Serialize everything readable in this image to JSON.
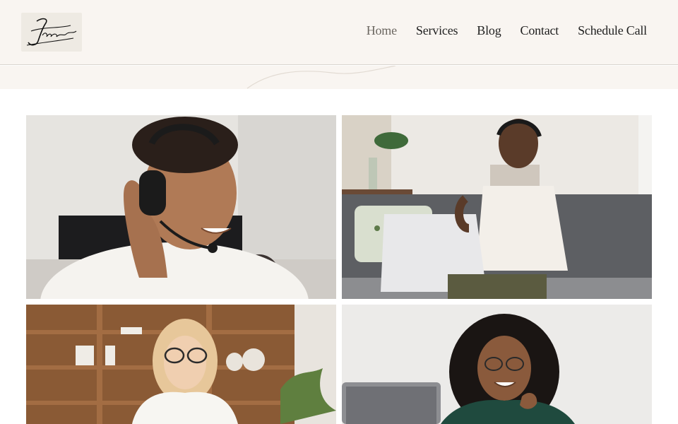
{
  "logo": {
    "text": "Jamal",
    "icon": "signature-logo"
  },
  "nav": {
    "items": [
      {
        "label": "Home",
        "active": true
      },
      {
        "label": "Services",
        "active": false
      },
      {
        "label": "Blog",
        "active": false
      },
      {
        "label": "Contact",
        "active": false
      },
      {
        "label": "Schedule Call",
        "active": false
      }
    ]
  },
  "colors": {
    "header_bg": "#f9f5f1",
    "nav_text": "#1f1f1f",
    "nav_active": "#6b6660"
  },
  "gallery": {
    "photos": [
      {
        "subject": "man-with-headset-photo"
      },
      {
        "subject": "woman-on-laptop-sofa-photo"
      },
      {
        "subject": "woman-with-glasses-bookshelf-photo"
      },
      {
        "subject": "woman-curly-hair-photo"
      }
    ]
  }
}
